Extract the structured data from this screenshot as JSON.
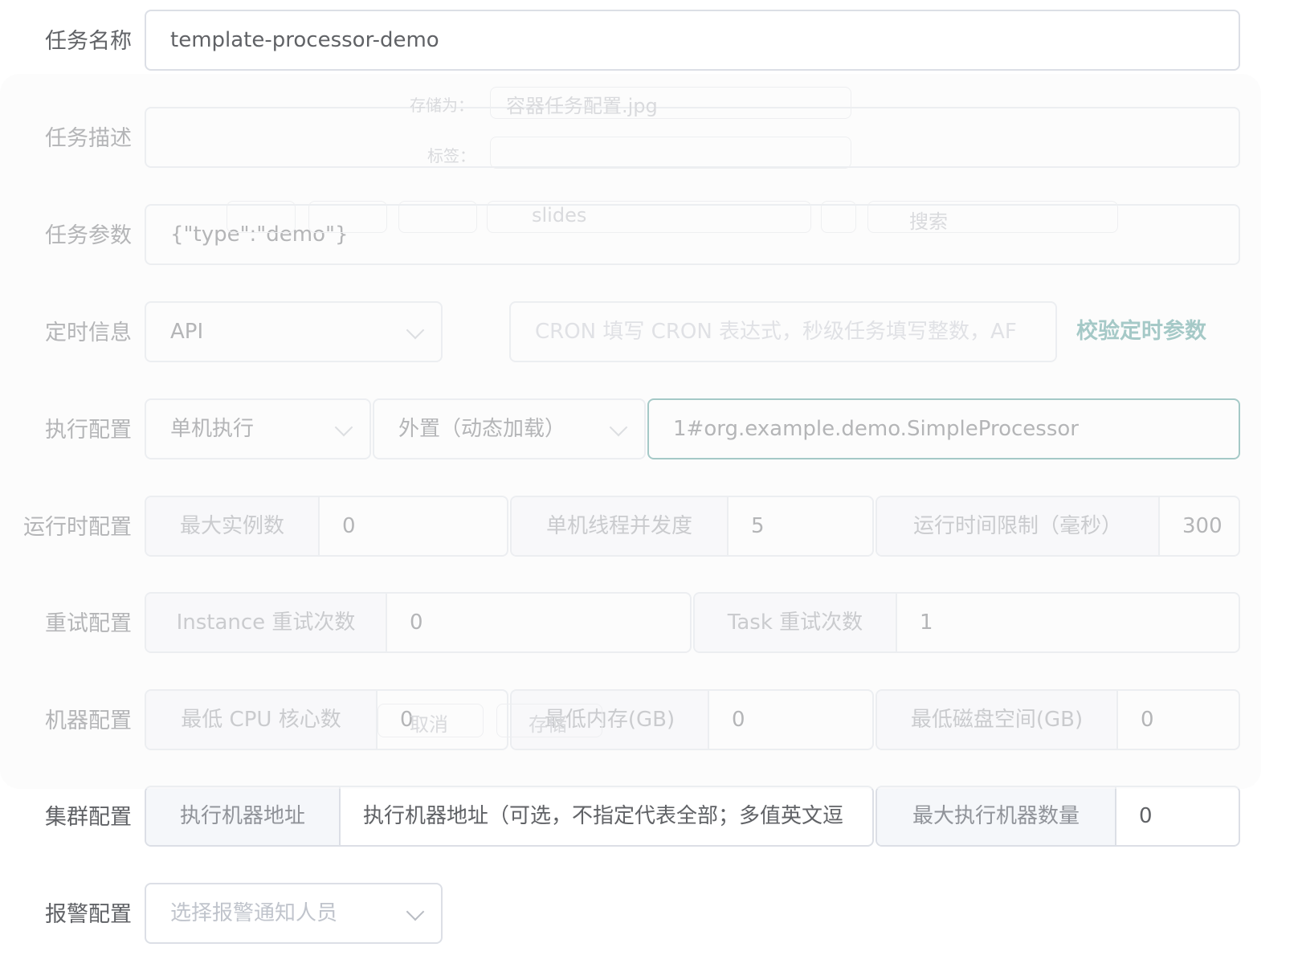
{
  "form": {
    "task_name": {
      "label": "任务名称",
      "value": "template-processor-demo"
    },
    "task_desc": {
      "label": "任务描述",
      "value": ""
    },
    "task_params": {
      "label": "任务参数",
      "value": "{\"type\":\"demo\"}"
    },
    "schedule": {
      "label": "定时信息",
      "type_value": "API",
      "cron_placeholder": "CRON 填写 CRON 表达式，秒级任务填写整数，AF",
      "validate_label": "校验定时参数"
    },
    "execute": {
      "label": "执行配置",
      "mode_value": "单机执行",
      "processor_type_value": "外置（动态加载）",
      "processor_info_value": "1#org.example.demo.SimpleProcessor"
    },
    "runtime": {
      "label": "运行时配置",
      "max_instances_label": "最大实例数",
      "max_instances_value": "0",
      "concurrency_label": "单机线程并发度",
      "concurrency_value": "5",
      "time_limit_label": "运行时间限制（毫秒）",
      "time_limit_value": "300"
    },
    "retry": {
      "label": "重试配置",
      "instance_retry_label": "Instance 重试次数",
      "instance_retry_value": "0",
      "task_retry_label": "Task 重试次数",
      "task_retry_value": "1"
    },
    "machine": {
      "label": "机器配置",
      "min_cpu_label": "最低 CPU 核心数",
      "min_cpu_value": "0",
      "min_memory_label": "最低内存(GB)",
      "min_memory_value": "0",
      "min_disk_label": "最低磁盘空间(GB)",
      "min_disk_value": "0"
    },
    "cluster": {
      "label": "集群配置",
      "address_label": "执行机器地址",
      "address_placeholder": "执行机器地址（可选，不指定代表全部；多值英文逗",
      "max_workers_label": "最大执行机器数量",
      "max_workers_value": "0"
    },
    "alarm": {
      "label": "报警配置",
      "receivers_placeholder": "选择报警通知人员"
    }
  },
  "ghost_dialog": {
    "save_as_label": "存储为：",
    "save_as_value": "容器任务配置.jpg",
    "tags_label": "标签：",
    "folder": "slides",
    "search_placeholder": "搜索",
    "cancel": "取消",
    "save": "存储"
  }
}
